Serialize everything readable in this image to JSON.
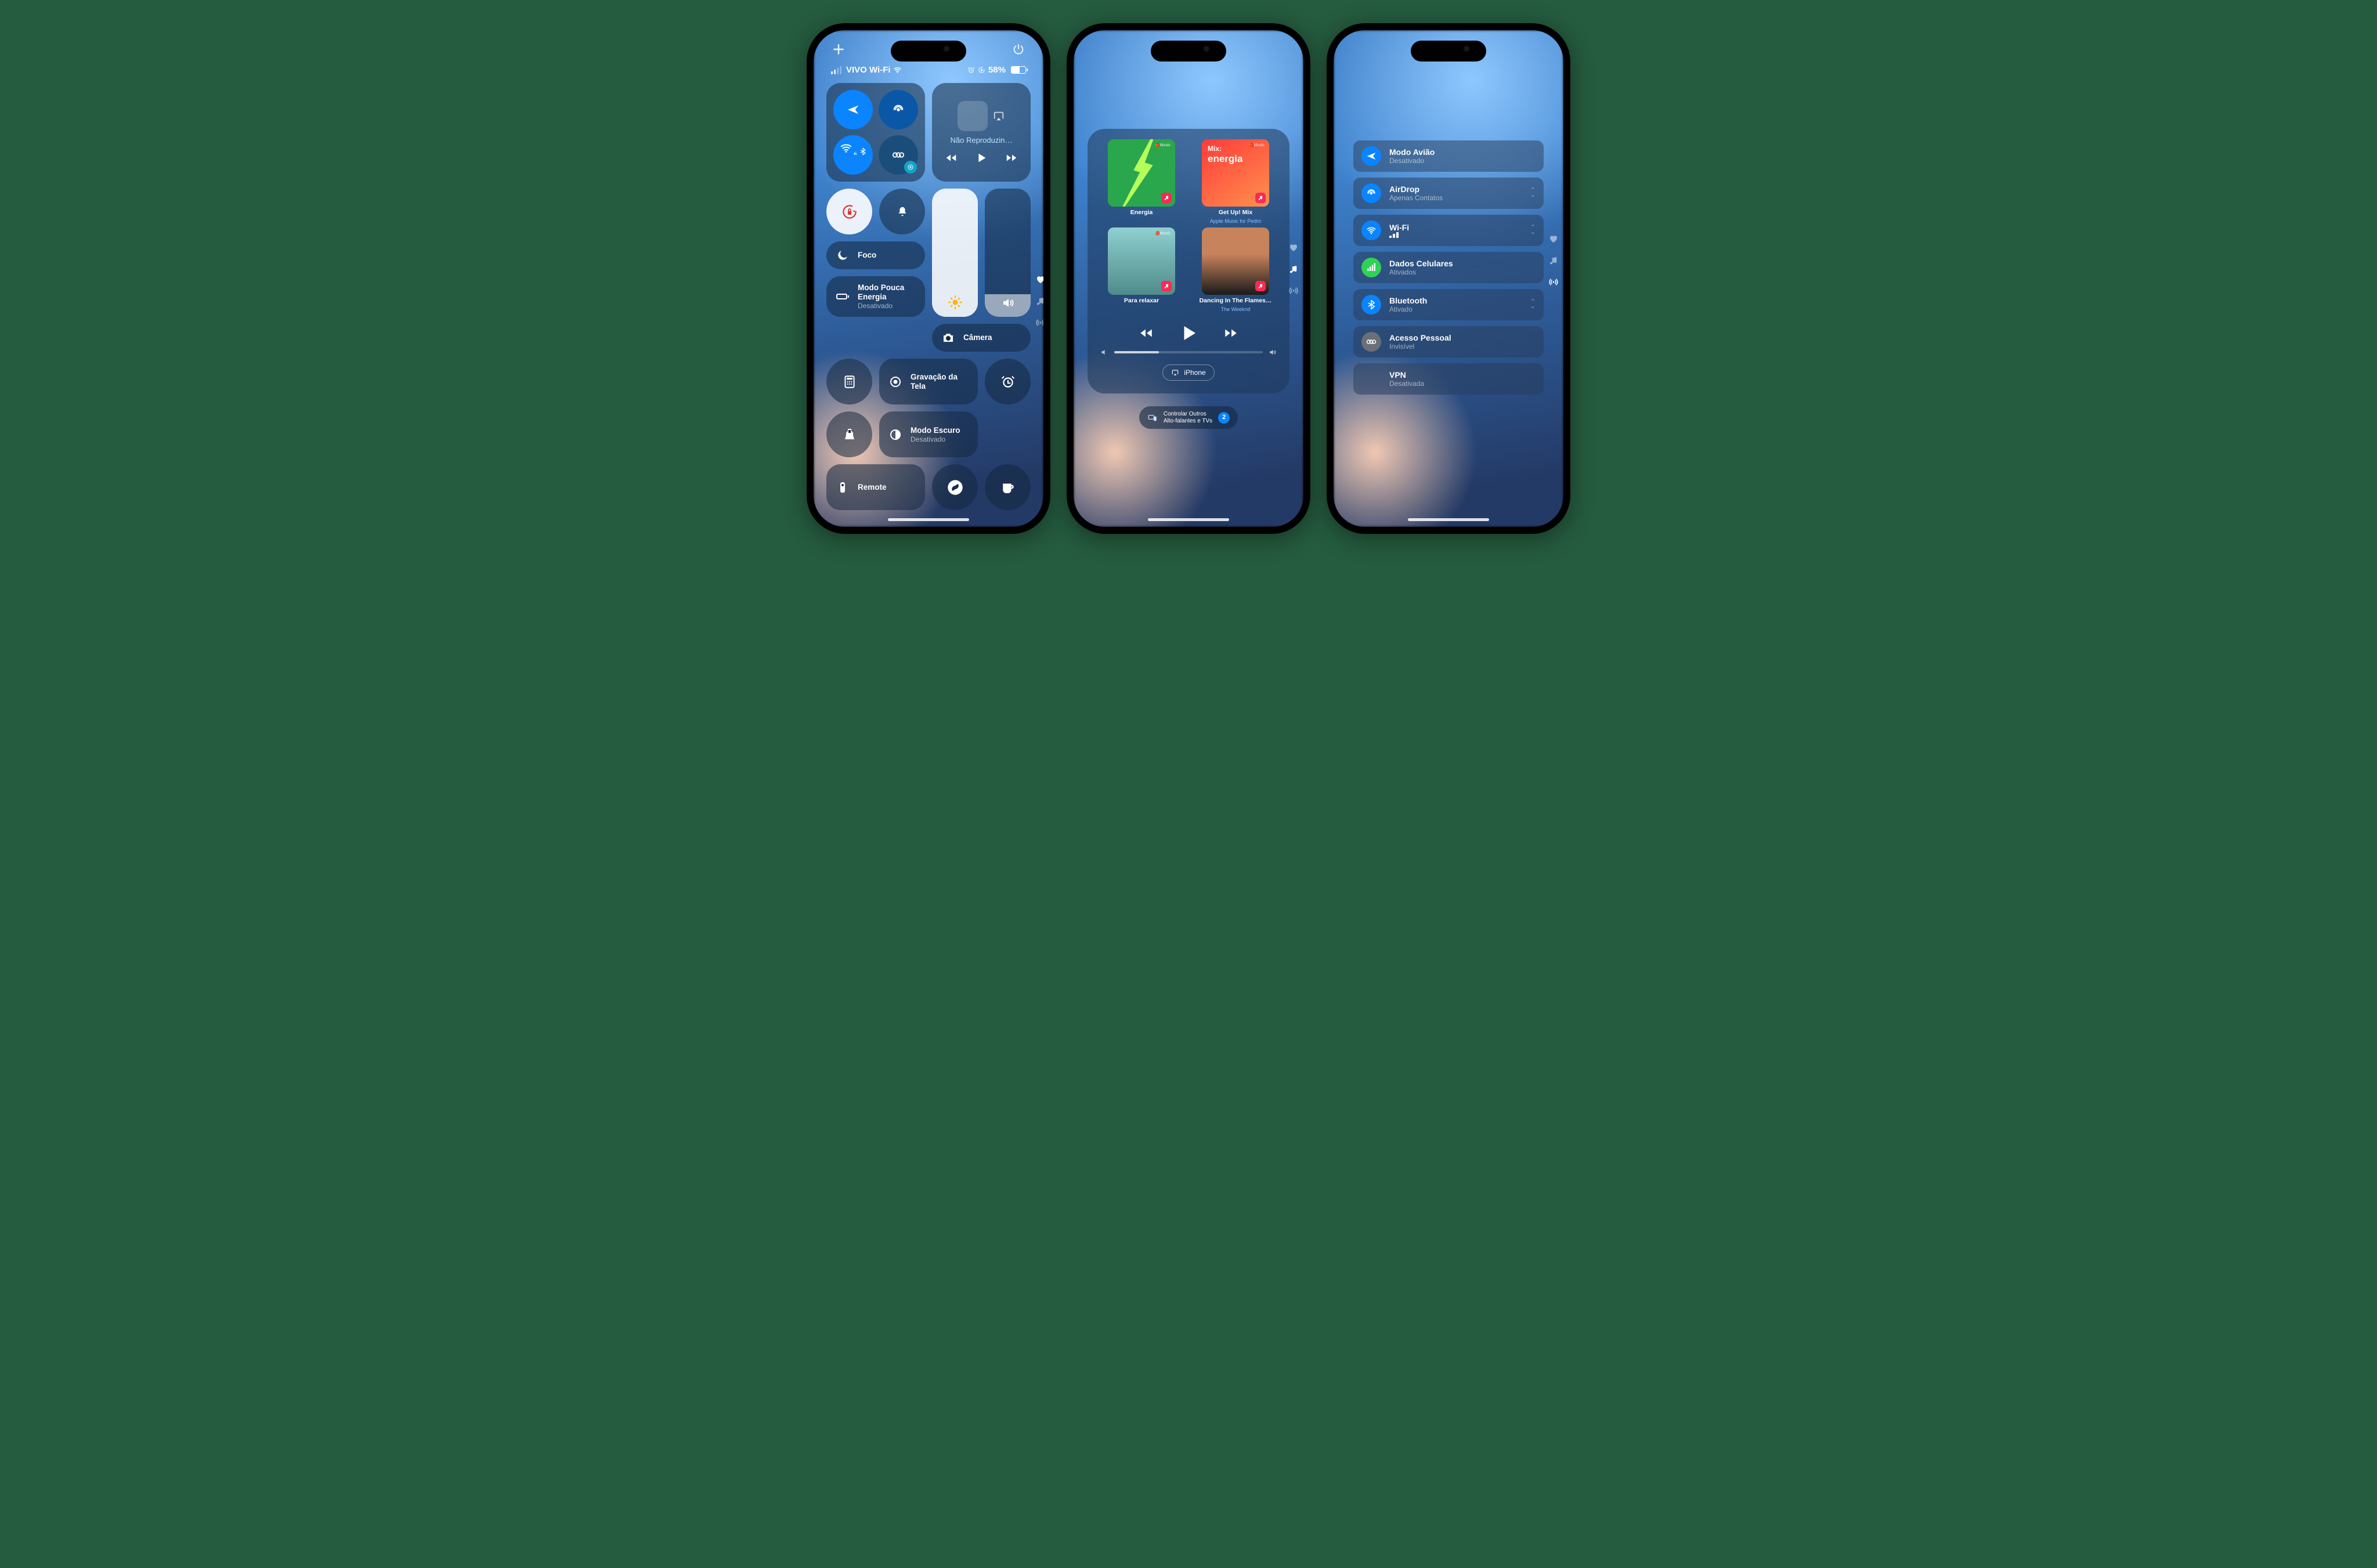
{
  "phone1": {
    "topbar": {
      "plus": "+",
      "power": true
    },
    "status": {
      "carrier": "VIVO Wi-Fi",
      "battery_pct": "58%"
    },
    "media": {
      "title": "Não Reproduzin…"
    },
    "focus": "Foco",
    "low_power": {
      "title": "Modo Pouca Energia",
      "sub": "Desativado"
    },
    "camera": "Câmera",
    "screen_rec": {
      "title": "Gravação da Tela"
    },
    "dark_mode": {
      "title": "Modo Escuro",
      "sub": "Desativado"
    },
    "remote": "Remote",
    "page_dots": [
      "heart",
      "music",
      "hotspot"
    ]
  },
  "phone2": {
    "albums": [
      {
        "title": "Energia",
        "sub": ""
      },
      {
        "title": "Get Up! Mix",
        "sub": "Apple Music for Pedro",
        "mix": "Mix:",
        "mixname": "energia"
      },
      {
        "title": "Para relaxar",
        "sub": ""
      },
      {
        "title": "Dancing In The Flames…",
        "sub": "The Weeknd"
      }
    ],
    "device": "iPhone",
    "other": {
      "l1": "Controlar Outros",
      "l2": "Alto-falantes e TVs",
      "count": "2"
    }
  },
  "phone3": {
    "rows": [
      {
        "icon": "airplane",
        "color": "#0a84ff",
        "title": "Modo Avião",
        "sub": "Desativado",
        "expand": false
      },
      {
        "icon": "airdrop",
        "color": "#0a84ff",
        "title": "AirDrop",
        "sub": "Apenas Contatos",
        "expand": true
      },
      {
        "icon": "wifi",
        "color": "#0a84ff",
        "title": "Wi-Fi",
        "sub": "██████",
        "expand": true
      },
      {
        "icon": "cell",
        "color": "#30d158",
        "title": "Dados Celulares",
        "sub": "Ativados",
        "expand": false
      },
      {
        "icon": "bt",
        "color": "#0a84ff",
        "title": "Bluetooth",
        "sub": "Ativado",
        "expand": true
      },
      {
        "icon": "hotspot",
        "color": "#6b6f77",
        "title": "Acesso Pessoal",
        "sub": "Invisível",
        "expand": false
      },
      {
        "icon": "vpn",
        "color": "",
        "title": "VPN",
        "sub": "Desativada",
        "expand": false
      }
    ]
  }
}
